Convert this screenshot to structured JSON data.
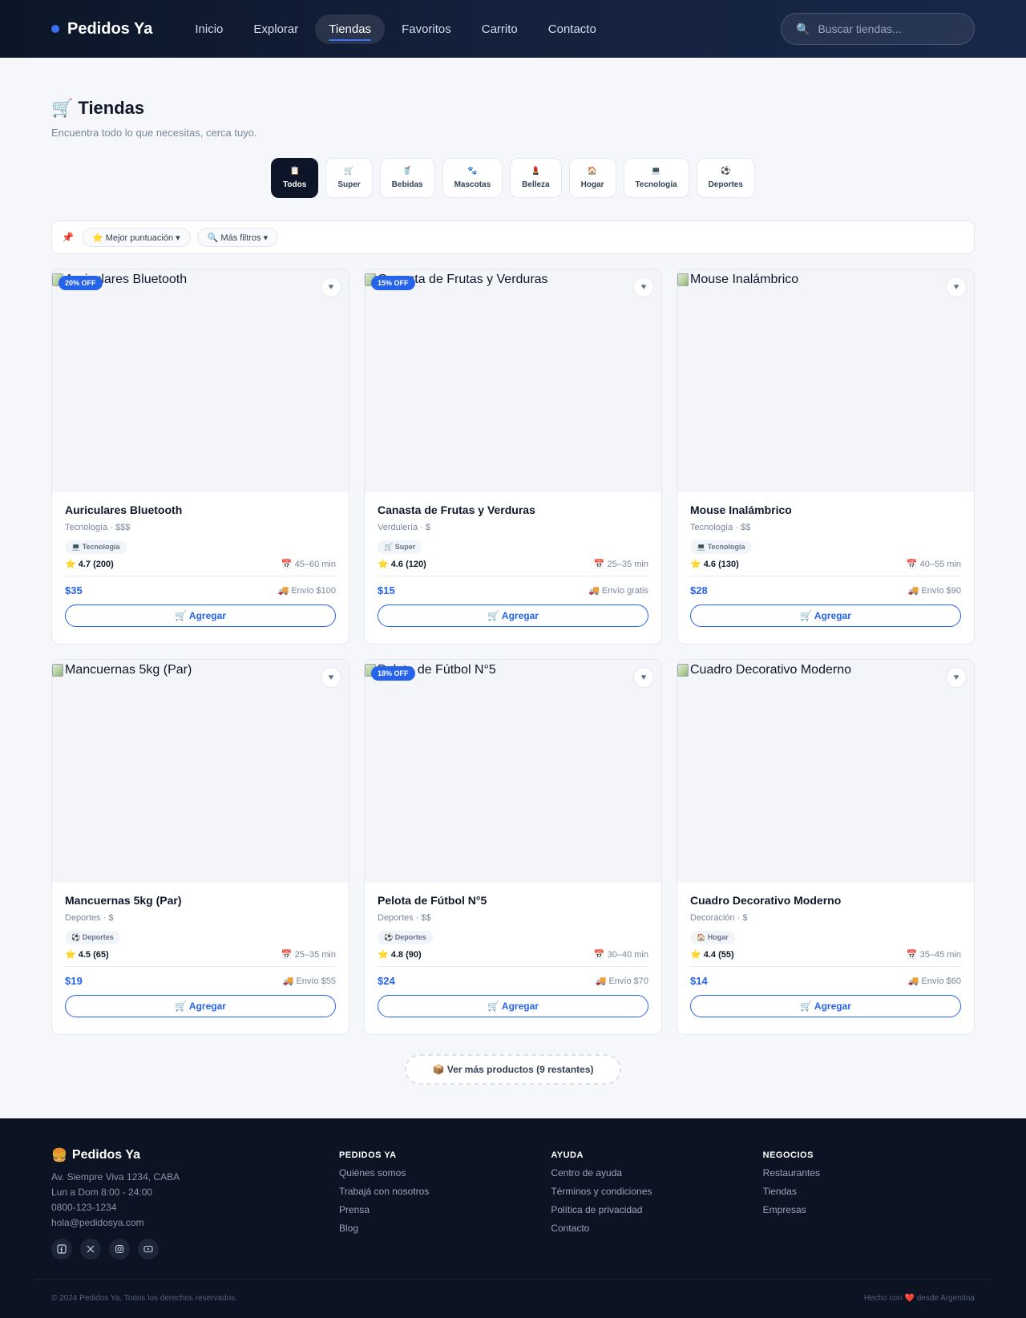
{
  "nav": {
    "brand": "Pedidos Ya",
    "links": [
      "Inicio",
      "Explorar",
      "Tiendas",
      "Favoritos",
      "Carrito",
      "Contacto"
    ],
    "active_link": "Tiendas",
    "search_placeholder": "Buscar tiendas..."
  },
  "header": {
    "title_icon": "🛒",
    "title": "Tiendas",
    "subtitle": "Encuentra todo lo que necesitas, cerca tuyo."
  },
  "categories": [
    {
      "icon": "📋",
      "label": "Todos",
      "active": true
    },
    {
      "icon": "🛒",
      "label": "Super"
    },
    {
      "icon": "🥤",
      "label": "Bebidas"
    },
    {
      "icon": "🐾",
      "label": "Mascotas"
    },
    {
      "icon": "💄",
      "label": "Belleza"
    },
    {
      "icon": "🏠",
      "label": "Hogar"
    },
    {
      "icon": "💻",
      "label": "Tecnología"
    },
    {
      "icon": "⚽",
      "label": "Deportes"
    }
  ],
  "filters": {
    "pin_icon": "📌",
    "chips": [
      {
        "label": "⭐ Mejor puntuación ▾"
      },
      {
        "label": "🔍 Más filtros ▾"
      }
    ]
  },
  "products": [
    {
      "name": "Auriculares Bluetooth",
      "meta": "Tecnología · $$$",
      "tag": "💻 Tecnología",
      "rating": "⭐ 4.7 (200)",
      "time": "📅 45–60 min",
      "price": "$35",
      "shipping": "🚚 Envío $100",
      "badge": "20% OFF",
      "img_alt": "Auriculares Bluetooth"
    },
    {
      "name": "Canasta de Frutas y Verduras",
      "meta": "Verdulería · $",
      "tag": "🛒 Super",
      "rating": "⭐ 4.6 (120)",
      "time": "📅 25–35 min",
      "price": "$15",
      "shipping": "🚚 Envío gratis",
      "badge": "15% OFF",
      "img_alt": "Canasta de Frutas y Verduras"
    },
    {
      "name": "Mouse Inalámbrico",
      "meta": "Tecnología · $$",
      "tag": "💻 Tecnología",
      "rating": "⭐ 4.6 (130)",
      "time": "📅 40–55 min",
      "price": "$28",
      "shipping": "🚚 Envío $90",
      "badge": "",
      "img_alt": "Mouse Inalámbrico"
    },
    {
      "name": "Mancuernas 5kg (Par)",
      "meta": "Deportes · $",
      "tag": "⚽ Deportes",
      "rating": "⭐ 4.5 (65)",
      "time": "📅 25–35 min",
      "price": "$19",
      "shipping": "🚚 Envío $55",
      "badge": "",
      "img_alt": "Mancuernas 5kg (Par)"
    },
    {
      "name": "Pelota de Fútbol N°5",
      "meta": "Deportes · $$",
      "tag": "⚽ Deportes",
      "rating": "⭐ 4.8 (90)",
      "time": "📅 30–40 min",
      "price": "$24",
      "shipping": "🚚 Envío $70",
      "badge": "18% OFF",
      "img_alt": "Pelota de Fútbol N°5"
    },
    {
      "name": "Cuadro Decorativo Moderno",
      "meta": "Decoración · $",
      "tag": "🏠 Hogar",
      "rating": "⭐ 4.4 (55)",
      "time": "📅 35–45 min",
      "price": "$14",
      "shipping": "🚚 Envío $60",
      "badge": "",
      "img_alt": "Cuadro Decorativo Moderno"
    }
  ],
  "fav_icon": "♥",
  "add_label": "🛒 Agregar",
  "more_button": "📦 Ver más productos (9 restantes)",
  "footer": {
    "brand_icon": "🍔",
    "brand": "Pedidos Ya",
    "address": "Av. Siempre Viva 1234, CABA",
    "hours": "Lun a Dom 8:00 - 24:00",
    "phone": "0800-123-1234",
    "email": "hola@pedidosya.com",
    "socials": [
      "facebook-icon",
      "x-icon",
      "instagram-icon",
      "youtube-icon"
    ],
    "columns": [
      {
        "heading": "PEDIDOS YA",
        "links": [
          "Quiénes somos",
          "Trabajá con nosotros",
          "Prensa",
          "Blog"
        ]
      },
      {
        "heading": "AYUDA",
        "links": [
          "Centro de ayuda",
          "Términos y condiciones",
          "Política de privacidad",
          "Contacto"
        ]
      },
      {
        "heading": "NEGOCIOS",
        "links": [
          "Restaurantes",
          "Tiendas",
          "Empresas"
        ]
      }
    ],
    "copyright": "© 2024 Pedidos Ya. Todos los derechos reservados.",
    "made_with": "Hecho con ❤️ desde Argentina"
  },
  "colors": {
    "accent": "#2563eb",
    "nav_bg": "#0c1628",
    "footer_bg": "#0c1424"
  }
}
